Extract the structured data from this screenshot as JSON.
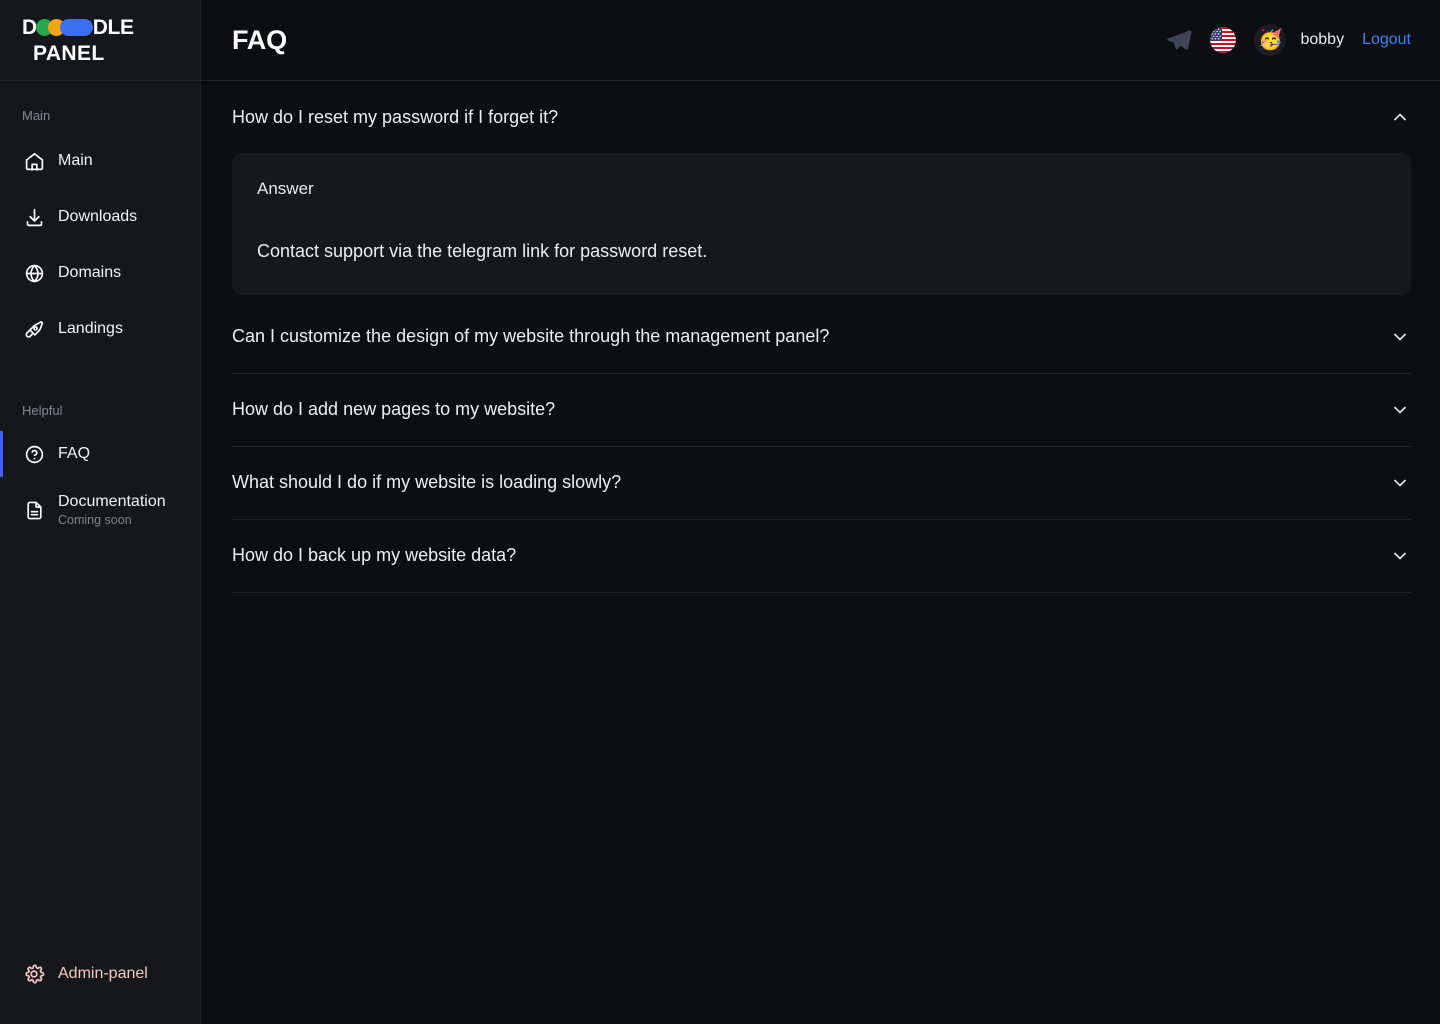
{
  "brand": {
    "line1_prefix": "D",
    "line1_suffix": "DLE",
    "line2": "PANEL",
    "colors": {
      "green": "#2aa84f",
      "yellow": "#f2a413",
      "blue": "#3b6ff0"
    }
  },
  "sidebar": {
    "sections": [
      {
        "label": "Main",
        "items": [
          {
            "label": "Main",
            "icon": "home-icon",
            "active": false
          },
          {
            "label": "Downloads",
            "icon": "download-icon",
            "active": false
          },
          {
            "label": "Domains",
            "icon": "globe-icon",
            "active": false
          },
          {
            "label": "Landings",
            "icon": "pen-nib-icon",
            "active": false
          }
        ]
      },
      {
        "label": "Helpful",
        "items": [
          {
            "label": "FAQ",
            "icon": "question-circle-icon",
            "active": true
          },
          {
            "label": "Documentation",
            "sub": "Coming soon",
            "icon": "document-icon",
            "active": false
          }
        ]
      }
    ],
    "footer": {
      "label": "Admin-panel",
      "icon": "gear-icon",
      "color": "#f4c9c0"
    },
    "active_accent": "#3f5efb"
  },
  "header": {
    "title": "FAQ",
    "telegram_icon": "telegram-icon",
    "language_flag": "us-flag-icon",
    "avatar_emoji": "🥳",
    "username": "bobby",
    "logout_label": "Logout",
    "logout_color": "#3b82f6"
  },
  "faq": {
    "answer_label": "Answer",
    "items": [
      {
        "question": "How do I reset my password if I forget it?",
        "expanded": true,
        "answer": "Contact support via the telegram link for password reset."
      },
      {
        "question": "Can I customize the design of my website through the management panel?",
        "expanded": false,
        "answer": ""
      },
      {
        "question": "How do I add new pages to my website?",
        "expanded": false,
        "answer": ""
      },
      {
        "question": "What should I do if my website is loading slowly?",
        "expanded": false,
        "answer": ""
      },
      {
        "question": "How do I back up my website data?",
        "expanded": false,
        "answer": ""
      }
    ]
  }
}
